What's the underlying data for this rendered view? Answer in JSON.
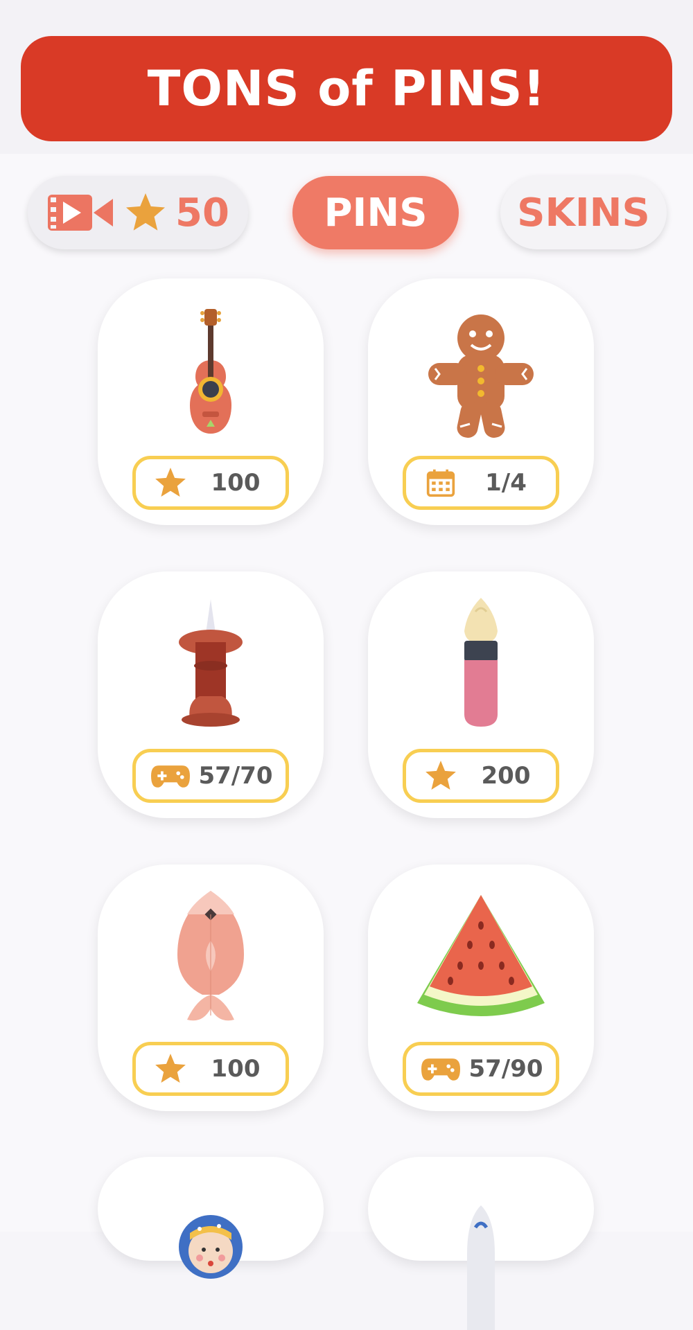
{
  "banner": {
    "title": "TONS of PINS!"
  },
  "reward": {
    "icon": "video-icon",
    "star_icon": "star-icon",
    "value": "50"
  },
  "tabs": [
    {
      "label": "PINS",
      "active": true
    },
    {
      "label": "SKINS",
      "active": false
    }
  ],
  "pins": [
    {
      "item": "guitar",
      "cost_icon": "star-icon",
      "cost": "100"
    },
    {
      "item": "gingerbread-man",
      "cost_icon": "calendar-icon",
      "cost": "1/4"
    },
    {
      "item": "pushpin",
      "cost_icon": "gamepad-icon",
      "cost": "57/70"
    },
    {
      "item": "paintbrush",
      "cost_icon": "star-icon",
      "cost": "200"
    },
    {
      "item": "fish",
      "cost_icon": "star-icon",
      "cost": "100"
    },
    {
      "item": "watermelon",
      "cost_icon": "gamepad-icon",
      "cost": "57/90"
    },
    {
      "item": "matryoshka-doll",
      "cost_icon": "",
      "cost": ""
    },
    {
      "item": "rocket",
      "cost_icon": "",
      "cost": ""
    }
  ],
  "colors": {
    "banner": "#d93a26",
    "accent": "#ef7a66",
    "price_border": "#f8ce52",
    "icon_gold": "#eaa23d"
  }
}
